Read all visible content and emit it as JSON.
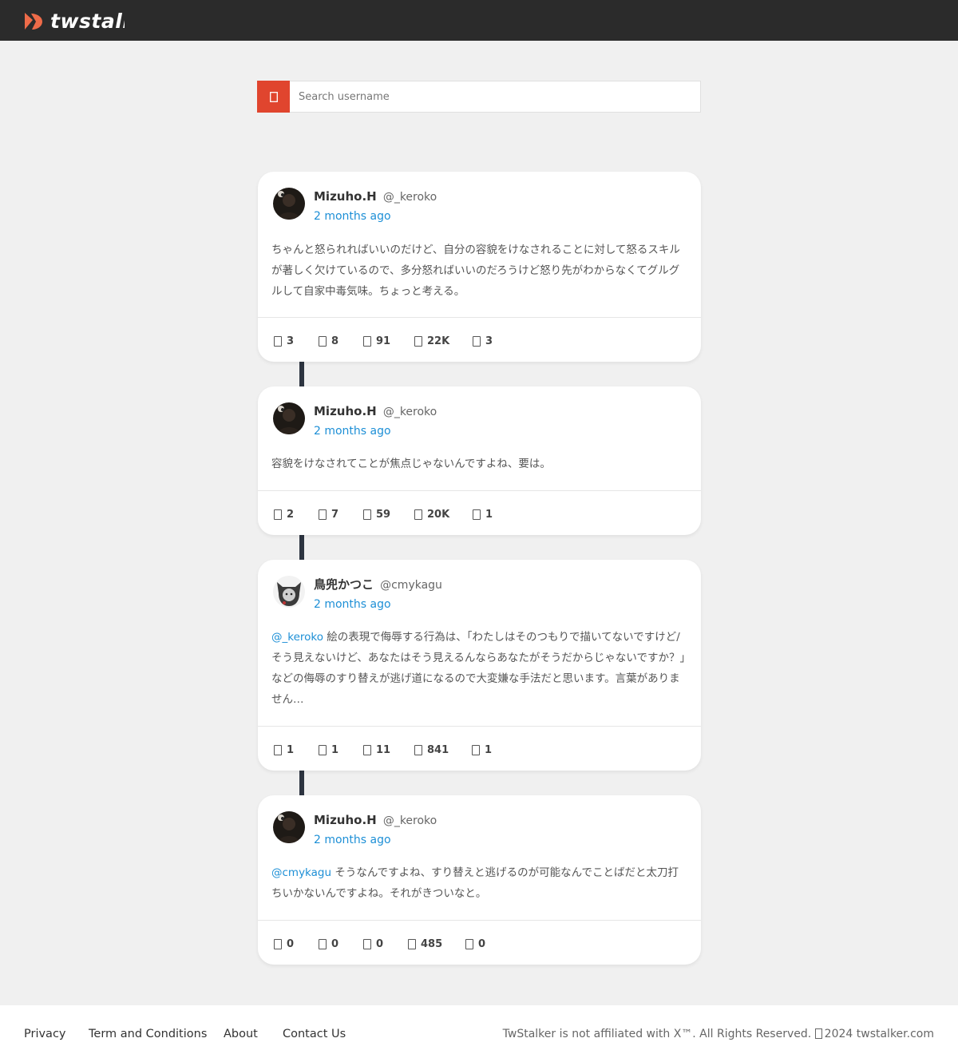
{
  "header": {
    "brand": "twstalker",
    "logo_color": "#ee6b49"
  },
  "search": {
    "placeholder": "Search username",
    "button_color": "#e0452e",
    "icon": "search-icon"
  },
  "tweets": [
    {
      "name": "Mizuho.H",
      "handle": "@_keroko",
      "time": "2 months ago",
      "text": "ちゃんと怒られればいいのだけど、自分の容貌をけなされることに対して怒るスキルが著しく欠けているので、多分怒ればいいのだろうけど怒り先がわからなくてグルグルして自家中毒気味。ちょっと考える。",
      "stats": {
        "replies": "3",
        "retweets": "8",
        "likes": "91",
        "views": "22K",
        "bookmarks": "3"
      }
    },
    {
      "name": "Mizuho.H",
      "handle": "@_keroko",
      "time": "2 months ago",
      "text": "容貌をけなされてことが焦点じゃないんですよね、要は。",
      "stats": {
        "replies": "2",
        "retweets": "7",
        "likes": "59",
        "views": "20K",
        "bookmarks": "1"
      }
    },
    {
      "name": "鳥兜かつこ",
      "handle": "@cmykagu",
      "time": "2 months ago",
      "mention": "@_keroko",
      "text": " 絵の表現で侮辱する行為は、「わたしはそのつもりで描いてないですけど/そう見えないけど、あなたはそう見えるんならあなたがそうだからじゃないですか？」などの侮辱のすり替えが逃げ道になるので大変嫌な手法だと思います。言葉がありません…",
      "stats": {
        "replies": "1",
        "retweets": "1",
        "likes": "11",
        "views": "841",
        "bookmarks": "1"
      }
    },
    {
      "name": "Mizuho.H",
      "handle": "@_keroko",
      "time": "2 months ago",
      "mention": "@cmykagu",
      "text": " そうなんですよね、すり替えと逃げるのが可能なんでことばだと太刀打ちいかないんですよね。それがきついなと。",
      "stats": {
        "replies": "0",
        "retweets": "0",
        "likes": "0",
        "views": "485",
        "bookmarks": "0"
      }
    }
  ],
  "footer": {
    "links": [
      "Privacy",
      "Term and Conditions",
      "About",
      "Contact Us"
    ],
    "copyright": "TwStalker is not affiliated with X™. All Rights Reserved.",
    "copyright_year": "2024 twstalker.com"
  },
  "colors": {
    "link": "#1d8fd6",
    "topbar": "#2b2b2b",
    "page_bg": "#f0f0f0"
  }
}
